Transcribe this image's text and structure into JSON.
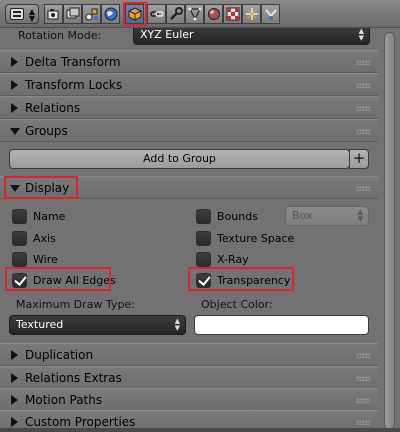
{
  "header": {
    "editor_type_icon": "properties-editor-icon",
    "tabs": [
      {
        "name": "render",
        "icon": "camera-icon"
      },
      {
        "name": "render-layers",
        "icon": "layers-icon"
      },
      {
        "name": "scene",
        "icon": "scene-icon"
      },
      {
        "name": "world",
        "icon": "world-icon"
      },
      {
        "name": "object",
        "icon": "cube-icon",
        "active": true
      },
      {
        "name": "constraints",
        "icon": "chain-link-icon"
      },
      {
        "name": "modifiers",
        "icon": "wrench-icon"
      },
      {
        "name": "data",
        "icon": "vertex-triangle-icon"
      },
      {
        "name": "material",
        "icon": "sphere-icon"
      },
      {
        "name": "texture",
        "icon": "checker-icon"
      },
      {
        "name": "particles",
        "icon": "particles-icon"
      },
      {
        "name": "physics",
        "icon": "physics-icon"
      }
    ]
  },
  "rotation_mode": {
    "label": "Rotation Mode:",
    "value": "XYZ Euler"
  },
  "panels": {
    "delta_transform": "Delta Transform",
    "transform_locks": "Transform Locks",
    "relations": "Relations",
    "groups": "Groups",
    "display": "Display",
    "duplication": "Duplication",
    "relations_extras": "Relations Extras",
    "motion_paths": "Motion Paths",
    "custom_properties": "Custom Properties"
  },
  "groups": {
    "add_to_group": "Add to Group",
    "plus": "+"
  },
  "display": {
    "name": {
      "label": "Name",
      "checked": false
    },
    "axis": {
      "label": "Axis",
      "checked": false
    },
    "wire": {
      "label": "Wire",
      "checked": false
    },
    "draw_all_edges": {
      "label": "Draw All Edges",
      "checked": true
    },
    "bounds": {
      "label": "Bounds",
      "checked": false
    },
    "bounds_type": "Box",
    "texture_space": {
      "label": "Texture Space",
      "checked": false
    },
    "x_ray": {
      "label": "X-Ray",
      "checked": false
    },
    "transparency": {
      "label": "Transparency",
      "checked": true
    },
    "max_draw_type_label": "Maximum Draw Type:",
    "max_draw_type_value": "Textured",
    "object_color_label": "Object Color:",
    "object_color": "#ffffff"
  },
  "colors": {
    "highlight": "#e0242b",
    "active_tab": "#5a77a8"
  }
}
